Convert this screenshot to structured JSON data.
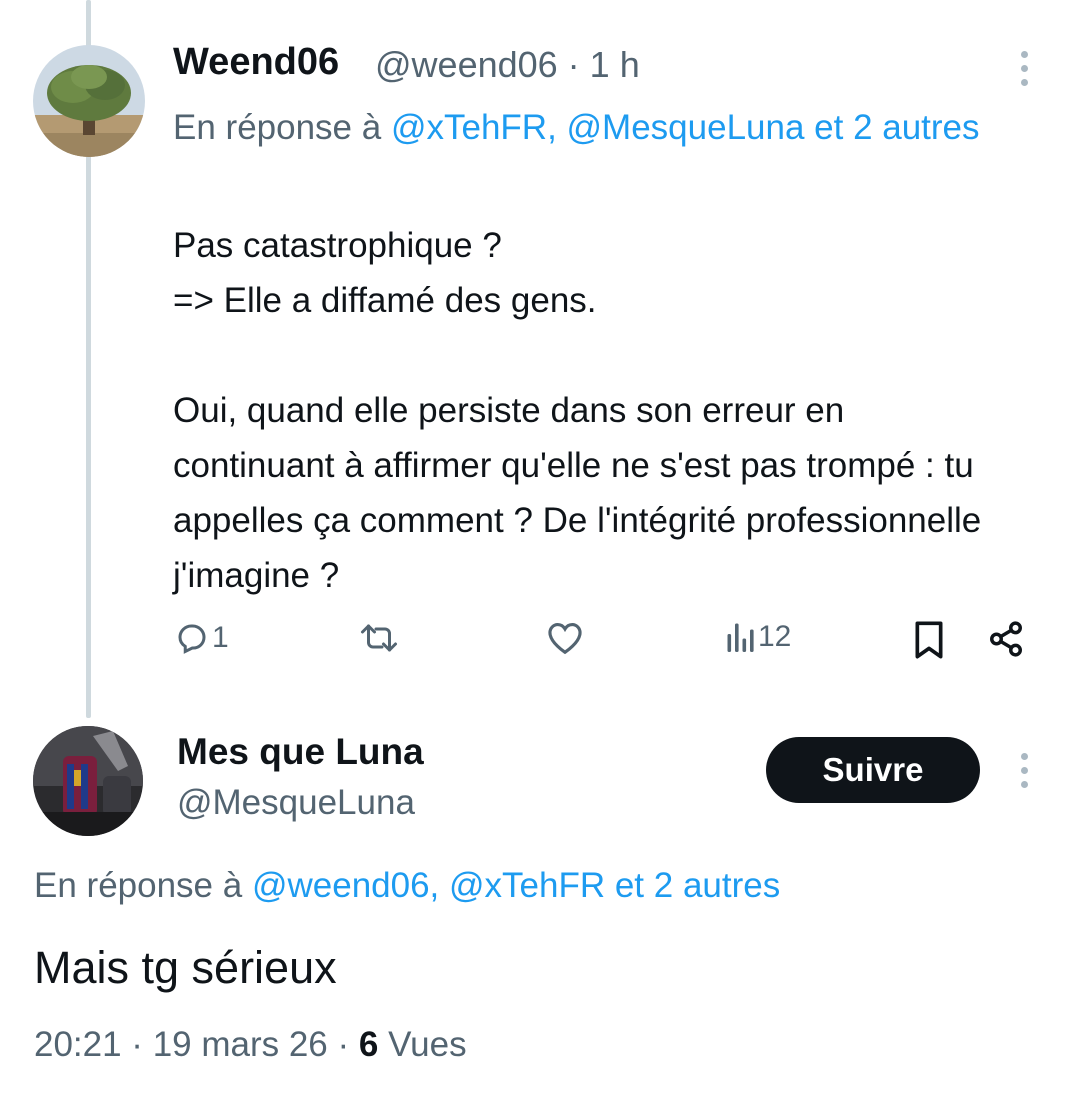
{
  "tweet1": {
    "display_name": "Weend06",
    "handle_time": "@weend06 · 1 h",
    "reply_prefix": "En réponse à",
    "reply_targets": "@xTehFR, @MesqueLuna et 2 autres",
    "body": "Pas catastrophique ?\n=> Elle a diffamé des gens.\n\nOui, quand elle persiste dans son erreur en continuant à affirmer qu'elle ne s'est pas trompé : tu appelles ça comment ? De l'intégrité professionnelle j'imagine ?",
    "actions": {
      "reply_count": "1",
      "views_count": "12"
    }
  },
  "tweet2": {
    "display_name": "Mes que Luna",
    "handle": "@MesqueLuna",
    "follow_label": "Suivre",
    "reply_prefix": "En réponse à",
    "reply_targets": "@weend06, @xTehFR et 2 autres",
    "body": "Mais tg sérieux",
    "time": "20:21 · 19 mars 26 · ",
    "views_count": "6",
    "views_label": "Vues"
  },
  "icons": {
    "reply": "reply-icon",
    "retweet": "retweet-icon",
    "like": "heart-icon",
    "views": "views-icon",
    "bookmark": "bookmark-icon",
    "share": "share-icon",
    "more": "more-icon"
  },
  "colors": {
    "link": "#1d9bf0",
    "muted": "#536471",
    "text": "#0f1419",
    "thread_line": "#cfd9de",
    "follow_button": "#0f1419"
  }
}
